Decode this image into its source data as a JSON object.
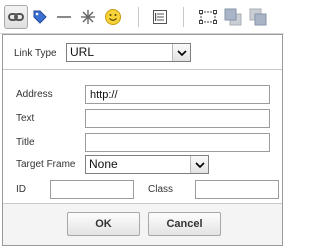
{
  "toolbar": {
    "icons": [
      "link-icon",
      "tag-icon",
      "horizontal-rule-icon",
      "special-character-icon",
      "smiley-icon",
      "table-icon",
      "image-icon",
      "bring-forward-icon",
      "send-backward-icon"
    ]
  },
  "dialog": {
    "link_type_label": "Link Type",
    "link_type_value": "URL",
    "address_label": "Address",
    "address_value": "http://",
    "text_label": "Text",
    "text_value": "",
    "title_label": "Title",
    "title_value": "",
    "target_label": "Target Frame",
    "target_value": "None",
    "id_label": "ID",
    "id_value": "",
    "class_label": "Class",
    "class_value": "",
    "ok_label": "OK",
    "cancel_label": "Cancel"
  }
}
